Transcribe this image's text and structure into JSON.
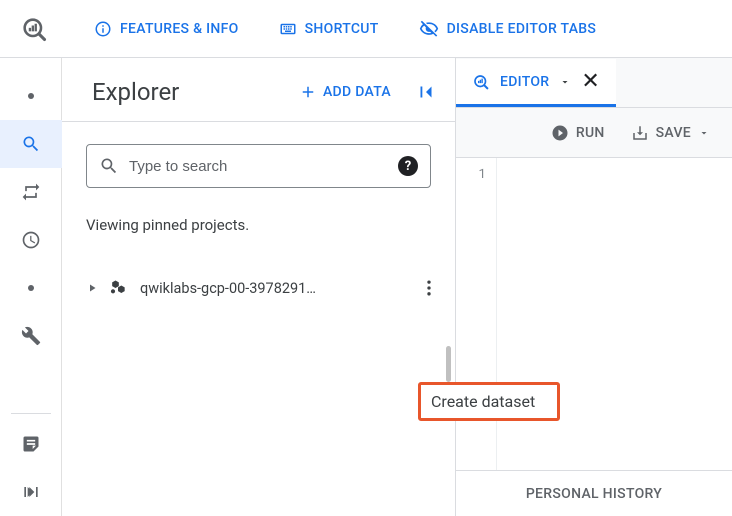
{
  "topbar": {
    "features_info": "FEATURES & INFO",
    "shortcut": "SHORTCUT",
    "disable_tabs": "DISABLE EDITOR TABS"
  },
  "rail": {
    "collapse_tooltip": "Collapse"
  },
  "explorer": {
    "title": "Explorer",
    "add_data": "ADD DATA",
    "search_placeholder": "Type to search",
    "pinned_message": "Viewing pinned projects.",
    "project_name": "qwiklabs-gcp-00-3978291…"
  },
  "menu": {
    "create_dataset": "Create dataset"
  },
  "editor": {
    "tab_label": "EDITOR",
    "run_label": "RUN",
    "save_label": "SAVE",
    "history_label": "PERSONAL HISTORY",
    "line_number": "1"
  },
  "colors": {
    "primary": "#1a73e8",
    "highlight_border": "#e8562b"
  }
}
